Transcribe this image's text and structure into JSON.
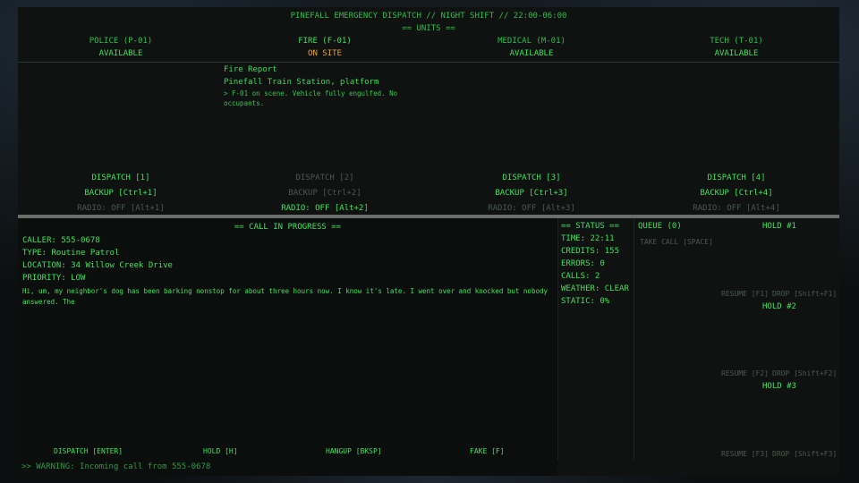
{
  "header": {
    "title": "PINEFALL EMERGENCY DISPATCH // NIGHT SHIFT // 22:00-06:00",
    "units_heading": "== UNITS =="
  },
  "units": [
    {
      "name": "POLICE (P-01)",
      "status": "AVAILABLE",
      "dispatch": "DISPATCH [1]",
      "backup": "BACKUP [Ctrl+1]",
      "radio": "RADIO: OFF [Alt+1]"
    },
    {
      "name": "FIRE (F-01)",
      "status": "ON SITE",
      "dispatch": "DISPATCH [2]",
      "backup": "BACKUP [Ctrl+2]",
      "radio": "RADIO: OFF [Alt+2]"
    },
    {
      "name": "MEDICAL (M-01)",
      "status": "AVAILABLE",
      "dispatch": "DISPATCH [3]",
      "backup": "BACKUP [Ctrl+3]",
      "radio": "RADIO: OFF [Alt+3]"
    },
    {
      "name": "TECH (T-01)",
      "status": "AVAILABLE",
      "dispatch": "DISPATCH [4]",
      "backup": "BACKUP [Ctrl+4]",
      "radio": "RADIO: OFF [Alt+4]"
    }
  ],
  "fire_report": {
    "title": "Fire Report",
    "location": "Pinefall Train Station, platform",
    "detail": "> F-01 on scene. Vehicle fully engulfed. No occupants."
  },
  "call": {
    "heading": "== CALL IN PROGRESS ==",
    "caller": "CALLER: 555-0678",
    "type": "TYPE: Routine Patrol",
    "location": "LOCATION: 34 Willow Creek Drive",
    "priority": "PRIORITY: LOW",
    "transcript_1": "Hi, um, my neighbor's dog has been barking nonstop for about three hours now. I know it's late. I went over and knocked but nobody",
    "transcript_2": "answered. The"
  },
  "status": {
    "heading": "== STATUS ==",
    "time": "TIME: 22:11",
    "credits": "CREDITS: 155",
    "errors": "ERRORS: 0",
    "calls": "CALLS: 2",
    "weather": "WEATHER: CLEAR",
    "static": "STATIC: 0%"
  },
  "queue": {
    "heading": "QUEUE (0)",
    "take_call": "TAKE CALL [SPACE]"
  },
  "holds": [
    {
      "label": "HOLD #1",
      "resume": "RESUME [F1]",
      "drop": "DROP [Shift+F1]"
    },
    {
      "label": "HOLD #2",
      "resume": "RESUME [F2]",
      "drop": "DROP [Shift+F2]"
    },
    {
      "label": "HOLD #3",
      "resume": "RESUME [F3]",
      "drop": "DROP [Shift+F3]"
    }
  ],
  "actions": {
    "dispatch": "DISPATCH [ENTER]",
    "hold": "HOLD [H]",
    "hangup": "HANGUP [BKSP]",
    "fake": "FAKE [F]"
  },
  "warning": ">> WARNING: Incoming call from 555-0678",
  "colors": {
    "green": "#3fe35c",
    "amber": "#e8a22a",
    "dim": "#4b5a4f"
  }
}
